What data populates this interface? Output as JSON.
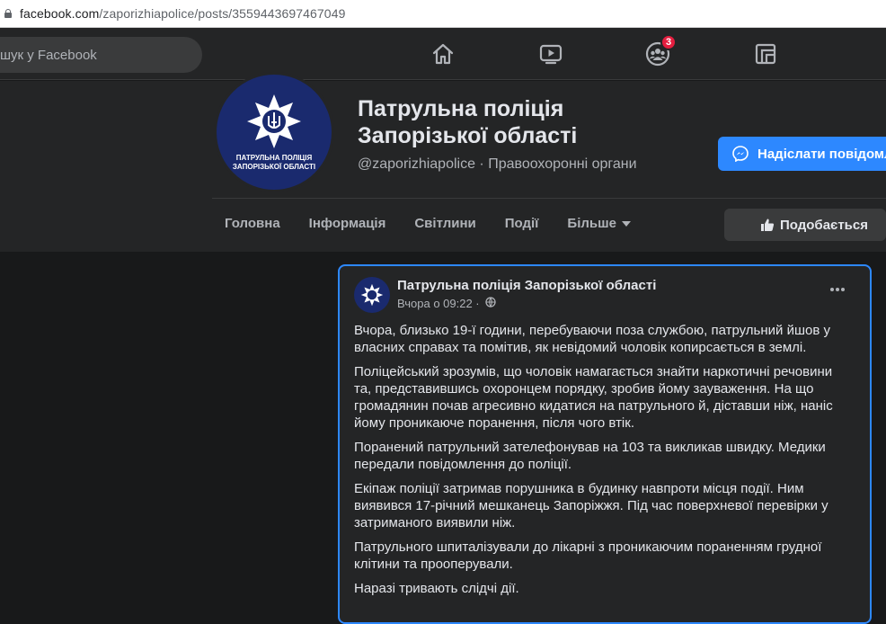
{
  "browser": {
    "url_domain": "facebook.com",
    "url_path": "/zaporizhiapolice/posts/3559443697467049"
  },
  "topbar": {
    "search_placeholder": "шук у Facebook",
    "notifications_badge": "3"
  },
  "page": {
    "name_line1": "Патрульна поліція",
    "name_line2": "Запорізької області",
    "subtitle": "@zaporizhiapolice · Правоохоронні органи",
    "avatar_caption_line1": "ПАТРУЛЬНА ПОЛІЦІЯ",
    "avatar_caption_line2": "ЗАПОРІЗЬКОЇ ОБЛАСТІ",
    "message_button": "Надіслати повідомлення",
    "like_button": "Подобається",
    "tabs": [
      {
        "label": "Головна"
      },
      {
        "label": "Інформація"
      },
      {
        "label": "Світлини"
      },
      {
        "label": "Події"
      },
      {
        "label": "Більше"
      }
    ]
  },
  "post": {
    "author": "Патрульна поліція Запорізької області",
    "time": "Вчора о 09:22 ·",
    "paragraphs": [
      "Вчора, близько 19-ї години, перебуваючи поза службою, патрульний йшов у власних справах та помітив, як невідомий чоловік копирсається в землі.",
      "Поліцейський зрозумів, що чоловік намагається знайти наркотичні речовини та, представившись охоронцем порядку, зробив йому зауваження. На що громадянин почав агресивно кидатися на патрульного й, діставши ніж, наніс йому проникаюче поранення, після чого втік.",
      "Поранений патрульний зателефонував на 103 та викликав швидку. Медики передали повідомлення до поліції.",
      "Екіпаж поліції затримав порушника в будинку навпроти місця події. Ним виявився 17-річний мешканець Запоріжжя. Під час поверхневої перевірки у затриманого виявили ніж.",
      "Патрульного шпиталізували до лікарні з проникаючим пораненням грудної клітини та прооперували.",
      "Наразі тривають слідчі дії."
    ]
  },
  "colors": {
    "background": "#18191a",
    "surface": "#242526",
    "accent": "#2d88ff",
    "badge": "#e41e3f"
  }
}
